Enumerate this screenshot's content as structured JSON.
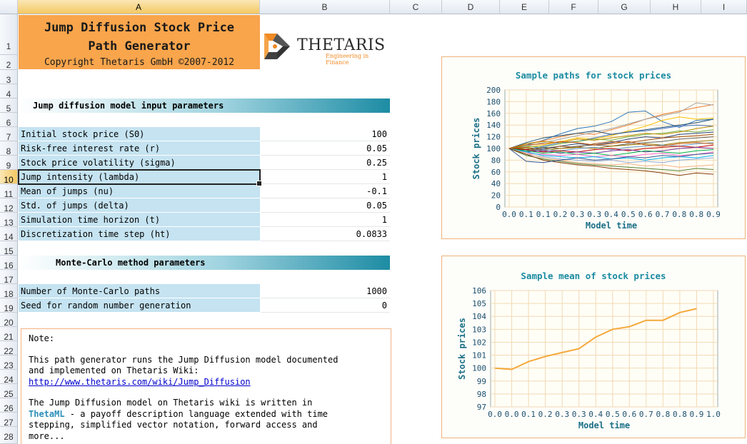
{
  "columns": [
    "A",
    "B",
    "C",
    "D",
    "E",
    "F",
    "G",
    "H",
    "I"
  ],
  "rows": [
    "1",
    "2",
    "3",
    "4",
    "5",
    "6",
    "7",
    "8",
    "9",
    "10",
    "11",
    "12",
    "13",
    "14",
    "15",
    "16",
    "17",
    "18",
    "19",
    "20",
    "21",
    "22",
    "23",
    "24",
    "25",
    "26",
    "27",
    "28"
  ],
  "title": {
    "line1": "Jump Diffusion Stock Price",
    "line2": "Path Generator",
    "copyright": "Copyright Thetaris GmbH ©2007-2012"
  },
  "logo": {
    "name": "THETARIS",
    "tagline": "Engineering in Finance"
  },
  "sections": {
    "jump": "Jump diffusion model input parameters",
    "mc": "Monte-Carlo method parameters"
  },
  "params": [
    {
      "label": "Initial stock price (S0)",
      "value": "100"
    },
    {
      "label": "Risk-free interest rate (r)",
      "value": "0.05"
    },
    {
      "label": "Stock price volatility (sigma)",
      "value": "0.25"
    },
    {
      "label": "Jump intensity (lambda)",
      "value": "1"
    },
    {
      "label": "Mean of jumps (nu)",
      "value": "-0.1"
    },
    {
      "label": "Std. of jumps (delta)",
      "value": "0.05"
    },
    {
      "label": "Simulation time horizon (t)",
      "value": "1"
    },
    {
      "label": "Discretization time step (ht)",
      "value": "0.0833"
    }
  ],
  "mc_params": [
    {
      "label": "Number of Monte-Carlo paths",
      "value": "1000"
    },
    {
      "label": "Seed for random number generation",
      "value": "0"
    }
  ],
  "note": {
    "heading": "Note:",
    "p1a": "This path generator runs the Jump Diffusion model documented",
    "p1b": "and implemented on Thetaris Wiki:",
    "link": "http://www.thetaris.com/wiki/Jump_Diffusion",
    "p2a": "The Jump Diffusion model on Thetaris wiki is written in",
    "p2b_link": "ThetaML",
    "p2b_rest": " - a payoff description language extended with time",
    "p2c": "stepping, simplified vector notation, forward access and",
    "p2d": "more..."
  },
  "chart_data": [
    {
      "type": "line",
      "title": "Sample paths for stock prices",
      "xlabel": "Model time",
      "ylabel": "Stock prices",
      "x_ticks": [
        "0.0",
        "0.1",
        "0.1",
        "0.2",
        "0.3",
        "0.3",
        "0.4",
        "0.5",
        "0.6",
        "0.7",
        "0.8",
        "0.8",
        "0.9"
      ],
      "y_ticks": [
        "0",
        "20",
        "40",
        "60",
        "80",
        "100",
        "120",
        "140",
        "160",
        "180",
        "200"
      ],
      "ylim": [
        0,
        200
      ],
      "grid": true,
      "series": [
        {
          "color": "#2e75b6",
          "values": [
            100,
            106,
            114,
            125,
            134,
            138,
            146,
            162,
            164,
            146,
            136,
            148,
            150
          ]
        },
        {
          "color": "#ed7d31",
          "values": [
            100,
            108,
            113,
            120,
            126,
            124,
            132,
            140,
            150,
            158,
            164,
            170,
            175
          ]
        },
        {
          "color": "#a5a5a5",
          "values": [
            100,
            104,
            110,
            116,
            122,
            128,
            134,
            142,
            150,
            156,
            162,
            178,
            174
          ]
        },
        {
          "color": "#ffc000",
          "values": [
            100,
            102,
            106,
            112,
            118,
            116,
            122,
            130,
            138,
            148,
            154,
            150,
            152
          ]
        },
        {
          "color": "#4472c4",
          "values": [
            100,
            98,
            104,
            110,
            112,
            118,
            124,
            128,
            130,
            134,
            138,
            140,
            138
          ]
        },
        {
          "color": "#70ad47",
          "values": [
            100,
            104,
            102,
            108,
            112,
            116,
            114,
            120,
            124,
            126,
            130,
            128,
            132
          ]
        },
        {
          "color": "#264478",
          "values": [
            100,
            96,
            100,
            104,
            108,
            106,
            110,
            116,
            120,
            118,
            124,
            126,
            128
          ]
        },
        {
          "color": "#9e480e",
          "values": [
            100,
            102,
            98,
            104,
            102,
            108,
            112,
            110,
            114,
            118,
            120,
            122,
            124
          ]
        },
        {
          "color": "#636363",
          "values": [
            100,
            98,
            102,
            100,
            104,
            106,
            104,
            108,
            110,
            112,
            116,
            118,
            120
          ]
        },
        {
          "color": "#997300",
          "values": [
            100,
            100,
            96,
            100,
            102,
            100,
            104,
            106,
            108,
            106,
            110,
            112,
            114
          ]
        },
        {
          "color": "#5b9bd5",
          "values": [
            100,
            96,
            98,
            96,
            100,
            102,
            98,
            102,
            104,
            106,
            104,
            108,
            110
          ]
        },
        {
          "color": "#c00000",
          "values": [
            100,
            98,
            94,
            96,
            94,
            98,
            100,
            96,
            100,
            102,
            104,
            102,
            106
          ]
        },
        {
          "color": "#7030a0",
          "values": [
            100,
            94,
            96,
            92,
            94,
            92,
            96,
            98,
            94,
            96,
            100,
            102,
            100
          ]
        },
        {
          "color": "#00b050",
          "values": [
            100,
            96,
            92,
            94,
            90,
            92,
            88,
            92,
            96,
            94,
            92,
            96,
            98
          ]
        },
        {
          "color": "#ff66cc",
          "values": [
            100,
            92,
            90,
            88,
            90,
            86,
            88,
            86,
            90,
            92,
            88,
            90,
            94
          ]
        },
        {
          "color": "#00b0f0",
          "values": [
            100,
            94,
            88,
            86,
            84,
            86,
            82,
            84,
            80,
            84,
            86,
            84,
            88
          ]
        },
        {
          "color": "#8faadc",
          "values": [
            100,
            90,
            86,
            82,
            80,
            78,
            80,
            76,
            78,
            76,
            80,
            82,
            84
          ]
        },
        {
          "color": "#f4b183",
          "values": [
            100,
            92,
            84,
            80,
            76,
            74,
            72,
            74,
            70,
            72,
            68,
            70,
            72
          ]
        },
        {
          "color": "#548235",
          "values": [
            100,
            88,
            82,
            78,
            74,
            72,
            70,
            68,
            66,
            64,
            62,
            66,
            64
          ]
        },
        {
          "color": "#843c0c",
          "values": [
            100,
            90,
            80,
            76,
            72,
            70,
            66,
            64,
            62,
            58,
            54,
            58,
            56
          ]
        },
        {
          "color": "#1f4e79",
          "values": [
            100,
            110,
            118,
            122,
            126,
            130,
            124,
            128,
            132,
            136,
            140,
            144,
            150
          ]
        },
        {
          "color": "#bf9000",
          "values": [
            100,
            108,
            112,
            110,
            116,
            114,
            118,
            122,
            126,
            124,
            128,
            134,
            138
          ]
        },
        {
          "color": "#2f5597",
          "values": [
            100,
            78,
            76,
            80,
            84,
            80,
            82,
            86,
            84,
            88,
            86,
            90,
            92
          ]
        },
        {
          "color": "#c55a11",
          "values": [
            100,
            106,
            108,
            112,
            110,
            106,
            108,
            112,
            106,
            104,
            108,
            110,
            108
          ]
        }
      ]
    },
    {
      "type": "line",
      "title": "Sample mean of stock prices",
      "xlabel": "Model time",
      "ylabel": "Stock prices",
      "x_ticks": [
        "0.0",
        "0.0",
        "0.1",
        "0.2",
        "0.3",
        "0.3",
        "0.4",
        "0.5",
        "0.6",
        "0.7",
        "0.8",
        "0.8",
        "0.9",
        "1.0"
      ],
      "y_ticks": [
        "97",
        "98",
        "99",
        "100",
        "101",
        "102",
        "103",
        "104",
        "105",
        "106"
      ],
      "ylim": [
        97,
        106
      ],
      "grid": true,
      "series": [
        {
          "color": "#f4a93c",
          "values": [
            100.0,
            99.9,
            100.5,
            100.9,
            101.2,
            101.5,
            102.4,
            103.0,
            103.2,
            103.7,
            103.7,
            104.3,
            104.6
          ]
        }
      ]
    }
  ]
}
